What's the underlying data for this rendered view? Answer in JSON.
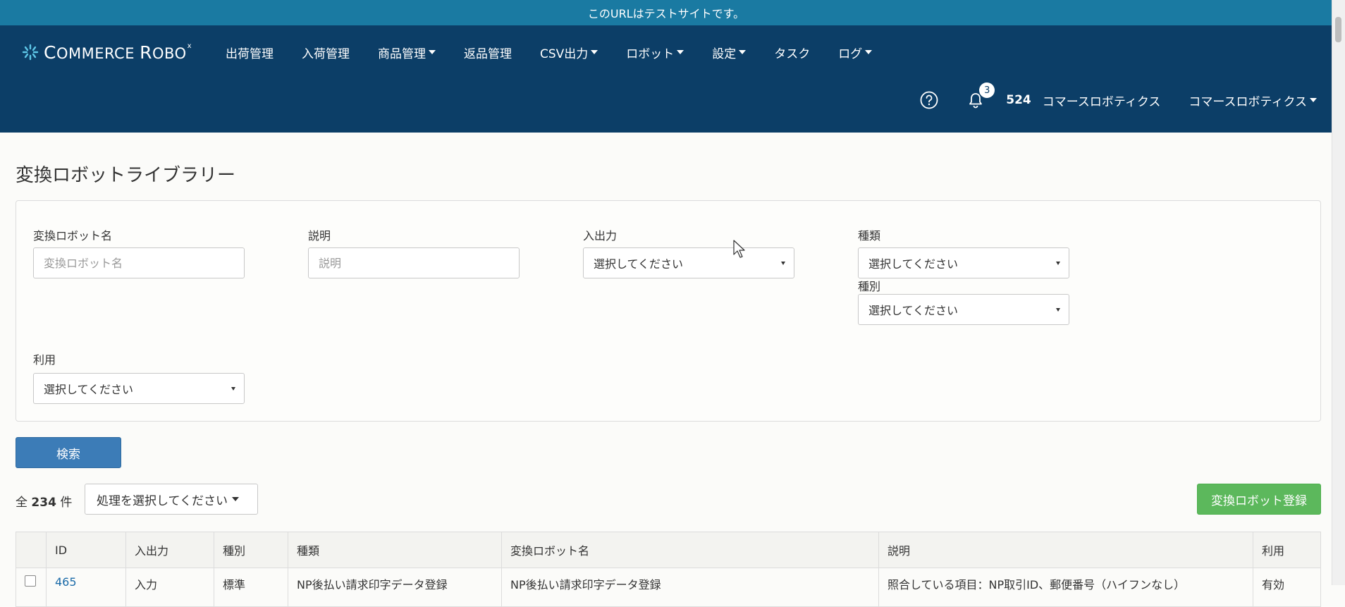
{
  "banner": {
    "text": "このURLはテストサイトです。"
  },
  "header": {
    "logo_text_c": "C",
    "logo_text_rest1": "OMMERCE ",
    "logo_text_r": "R",
    "logo_text_rest2": "OBO",
    "logo_sup": "x",
    "nav": [
      {
        "label": "出荷管理"
      },
      {
        "label": "入荷管理"
      },
      {
        "label": "商品管理"
      },
      {
        "label": "返品管理"
      },
      {
        "label": "CSV出力"
      },
      {
        "label": "ロボット"
      },
      {
        "label": "設定"
      },
      {
        "label": "タスク"
      },
      {
        "label": "ログ"
      }
    ],
    "notification_count": "3",
    "account_number": "524",
    "account_name": "コマースロボティクス",
    "user_menu": "コマースロボティクス"
  },
  "page": {
    "title": "変換ロボットライブラリー"
  },
  "filters": {
    "robot_name_label": "変換ロボット名",
    "robot_name_placeholder": "変換ロボット名",
    "description_label": "説明",
    "description_placeholder": "説明",
    "io_label": "入出力",
    "io_value": "選択してください",
    "kind_label": "種類",
    "kind_value": "選択してください",
    "category_label": "種別",
    "category_value": "選択してください",
    "usage_label": "利用",
    "usage_value": "選択してください",
    "search_button": "検索"
  },
  "results": {
    "count_prefix": "全",
    "count": "234",
    "count_suffix": "件",
    "bulk_action": "処理を選択してください",
    "register_button": "変換ロボット登録"
  },
  "table": {
    "headers": [
      "ID",
      "入出力",
      "種別",
      "種類",
      "変換ロボット名",
      "説明",
      "利用"
    ],
    "rows": [
      {
        "id": "465",
        "io": "入力",
        "category": "標準",
        "kind": "NP後払い請求印字データ登録",
        "name": "NP後払い請求印字データ登録",
        "description": "照合している項目：NP取引ID、郵便番号（ハイフンなし）",
        "usage": "有効"
      }
    ]
  },
  "colors": {
    "navbar": "#0c3e67",
    "banner": "#1a7aa2",
    "search_button": "#3c7cb7",
    "register_button": "#5cb85c"
  }
}
